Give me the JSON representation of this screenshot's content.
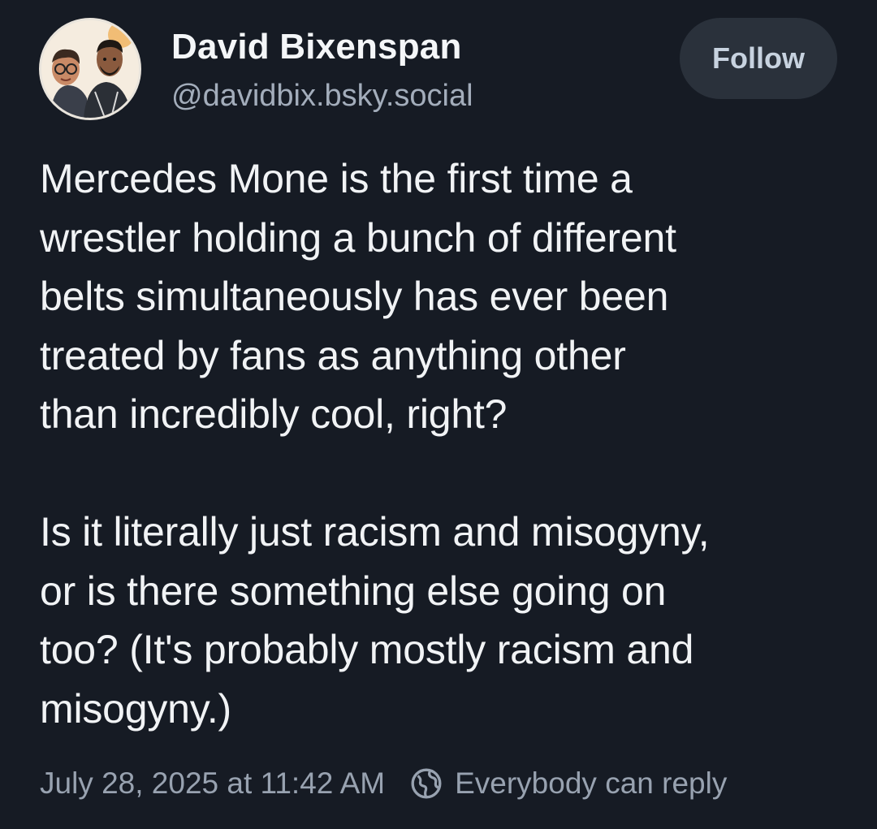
{
  "author": {
    "display_name": "David Bixenspan",
    "handle": "@davidbix.bsky.social",
    "avatar_icon": "avatar-photo"
  },
  "actions": {
    "follow_label": "Follow"
  },
  "post": {
    "paragraph_1_lines": [
      "Mercedes Mone is the first time a",
      "wrestler holding a bunch of different",
      "belts simultaneously has ever been",
      "treated by fans as anything other",
      "than incredibly cool, right?"
    ],
    "paragraph_2_lines": [
      "Is it literally just racism and misogyny,",
      "or is there something else going on",
      "too? (It's probably mostly racism and",
      "misogyny.)"
    ]
  },
  "meta": {
    "timestamp": "July 28, 2025 at 11:42 AM",
    "reply_icon": "globe-icon",
    "reply_setting": "Everybody can reply"
  },
  "colors": {
    "background": "#161b24",
    "text_primary": "#f1f3f5",
    "text_secondary": "#a3adbb",
    "button_bg": "#2a313b",
    "button_text": "#c7d2df"
  }
}
